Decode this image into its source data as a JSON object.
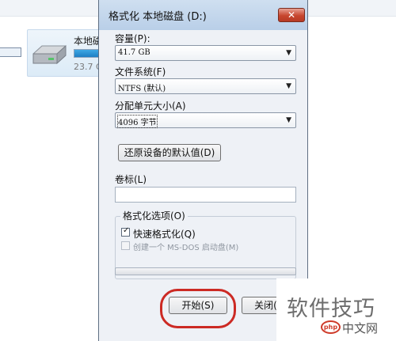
{
  "explorer": {
    "drive_name": "本地磁",
    "drive_free": "23.7 G",
    "drive_used_fraction": 0.85
  },
  "dialog": {
    "title": "格式化 本地磁盘 (D:)",
    "close_icon": "✕",
    "capacity": {
      "label": "容量(P):",
      "value": "41.7 GB"
    },
    "filesystem": {
      "label": "文件系统(F)",
      "value": "NTFS (默认)"
    },
    "allocation": {
      "label": "分配单元大小(A)",
      "value": "4096 字节"
    },
    "restore_defaults_label": "还原设备的默认值(D)",
    "volume_label": {
      "label": "卷标(L)",
      "value": ""
    },
    "format_options": {
      "title": "格式化选项(O)",
      "quick_format": {
        "label": "快速格式化(Q)",
        "checked": true
      },
      "msdos_boot": {
        "label": "创建一个 MS-DOS 启动盘(M)",
        "checked": false,
        "enabled": false
      }
    },
    "progress": 0,
    "start_label": "开始(S)",
    "close_label": "关闭(C)"
  },
  "watermark": {
    "text": "软件技巧",
    "logo": "php",
    "site": "中文网"
  },
  "colors": {
    "highlight_ring": "#cc2a24",
    "drive_bar": "#1e7fc4"
  }
}
